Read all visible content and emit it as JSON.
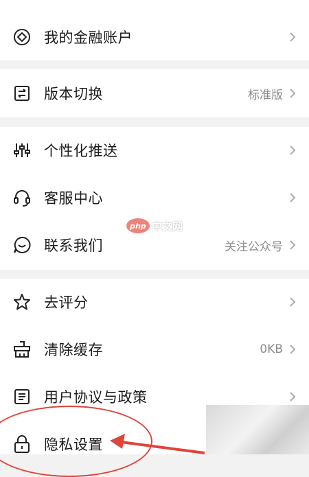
{
  "menu": {
    "group1": [
      {
        "label": "我的金融账户",
        "value": "",
        "icon": "finance-diamond-icon"
      }
    ],
    "group2": [
      {
        "label": "版本切换",
        "value": "标准版",
        "icon": "switch-icon"
      }
    ],
    "group3": [
      {
        "label": "个性化推送",
        "value": "",
        "icon": "sliders-icon"
      },
      {
        "label": "客服中心",
        "value": "",
        "icon": "headset-icon"
      },
      {
        "label": "联系我们",
        "value": "关注公众号",
        "icon": "chat-bubble-icon"
      }
    ],
    "group4": [
      {
        "label": "去评分",
        "value": "",
        "icon": "star-icon"
      },
      {
        "label": "清除缓存",
        "value": "0KB",
        "icon": "broom-icon"
      },
      {
        "label": "用户协议与政策",
        "value": "",
        "icon": "document-icon"
      },
      {
        "label": "隐私设置",
        "value": "",
        "icon": "lock-icon"
      }
    ]
  },
  "watermark": {
    "badge": "php",
    "text": "中文网"
  },
  "colors": {
    "annotation": "#e0443a",
    "separator": "#f2f2f2",
    "value_text": "#8a8a8a"
  }
}
